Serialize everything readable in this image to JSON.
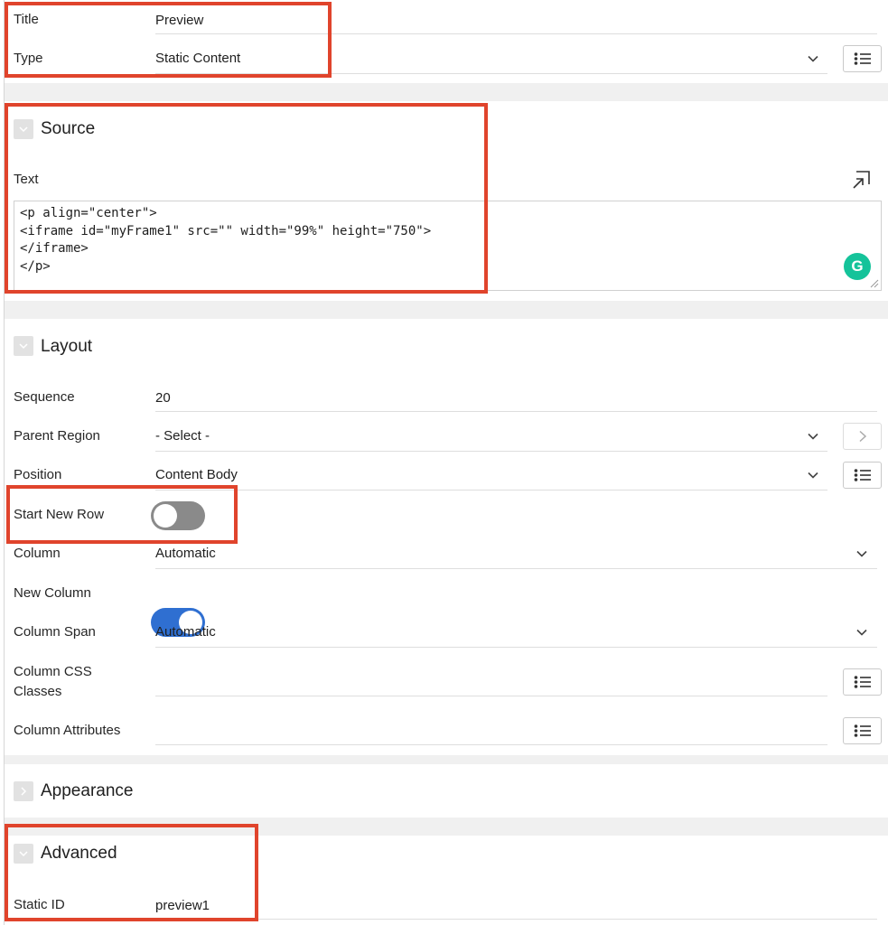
{
  "identification": {
    "title_label": "Title",
    "title_value": "Preview",
    "type_label": "Type",
    "type_value": "Static Content"
  },
  "source": {
    "section_title": "Source",
    "text_label": "Text",
    "code_lines": [
      "<p align=\"center\">",
      "<iframe id=\"myFrame1\" src=\"\" width=\"99%\" height=\"750\">",
      "</iframe>",
      "</p>"
    ],
    "grammarly_glyph": "G"
  },
  "layout": {
    "section_title": "Layout",
    "sequence_label": "Sequence",
    "sequence_value": "20",
    "parent_region_label": "Parent Region",
    "parent_region_value": "- Select -",
    "position_label": "Position",
    "position_value": "Content Body",
    "start_new_row_label": "Start New Row",
    "start_new_row_on": false,
    "column_label": "Column",
    "column_value": "Automatic",
    "new_column_label": "New Column",
    "new_column_on": true,
    "column_span_label": "Column Span",
    "column_span_value": "Automatic",
    "column_css_label_line1": "Column CSS",
    "column_css_label_line2": "Classes",
    "column_attributes_label": "Column Attributes"
  },
  "appearance": {
    "section_title": "Appearance"
  },
  "advanced": {
    "section_title": "Advanced",
    "static_id_label": "Static ID",
    "static_id_value": "preview1"
  },
  "colors": {
    "highlight_red": "#e0442c",
    "toggle_on_blue": "#2f6fd1",
    "toggle_off_gray": "#8a8a8a",
    "grammarly_green": "#15c39a"
  }
}
